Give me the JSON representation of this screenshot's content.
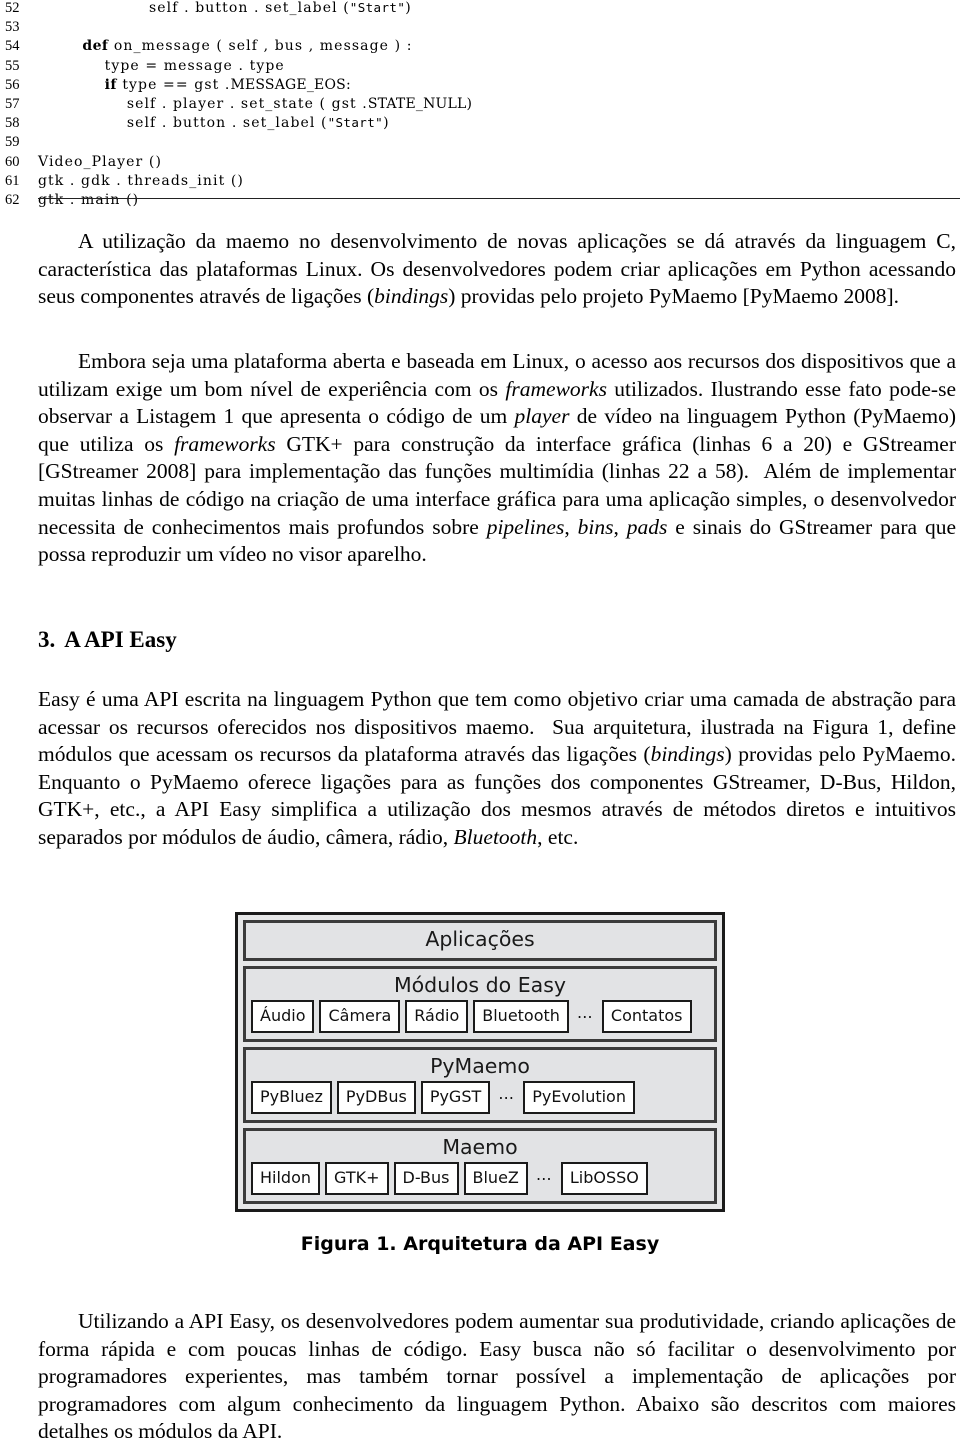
{
  "listing": {
    "lines": [
      {
        "no": "52",
        "indent": 20,
        "segments": [
          {
            "t": "self . button . set_label (",
            "k": "plain"
          },
          {
            "t": "\"Start\"",
            "k": "str"
          },
          {
            "t": ")",
            "k": "plain"
          }
        ]
      },
      {
        "no": "53",
        "indent": 0,
        "segments": []
      },
      {
        "no": "54",
        "indent": 8,
        "segments": [
          {
            "t": "def",
            "k": "kw"
          },
          {
            "t": " on_message ( self , bus , message ) :",
            "k": "plain"
          }
        ]
      },
      {
        "no": "55",
        "indent": 12,
        "segments": [
          {
            "t": "type = message . type",
            "k": "plain"
          }
        ]
      },
      {
        "no": "56",
        "indent": 12,
        "segments": [
          {
            "t": "if",
            "k": "kw"
          },
          {
            "t": " type == gst .",
            "k": "plain"
          },
          {
            "t": "MESSAGE_EOS",
            "k": "sc"
          },
          {
            "t": ":",
            "k": "plain"
          }
        ]
      },
      {
        "no": "57",
        "indent": 16,
        "segments": [
          {
            "t": "self . player . set_state ( gst .",
            "k": "plain"
          },
          {
            "t": "STATE_NULL",
            "k": "sc"
          },
          {
            "t": ")",
            "k": "plain"
          }
        ]
      },
      {
        "no": "58",
        "indent": 16,
        "segments": [
          {
            "t": "self . button . set_label (",
            "k": "plain"
          },
          {
            "t": "\"Start\"",
            "k": "str"
          },
          {
            "t": ")",
            "k": "plain"
          }
        ]
      },
      {
        "no": "59",
        "indent": 0,
        "segments": []
      },
      {
        "no": "60",
        "indent": 0,
        "segments": [
          {
            "t": "Video_Player ()",
            "k": "plain"
          }
        ]
      },
      {
        "no": "61",
        "indent": 0,
        "segments": [
          {
            "t": "gtk . gdk . threads_init ()",
            "k": "plain"
          }
        ]
      },
      {
        "no": "62",
        "indent": 0,
        "segments": [
          {
            "t": "gtk . main ()",
            "k": "plain"
          }
        ]
      }
    ]
  },
  "paragraphs": {
    "p1": "A utilização da maemo no desenvolvimento de novas aplicações se dá através da linguagem C, característica das plataformas Linux. Os desenvolvedores podem criar aplicações em Python acessando seus componentes através de ligações (bindings) providas pelo projeto PyMaemo [PyMaemo 2008].",
    "p2": "Embora seja uma plataforma aberta e baseada em Linux, o acesso aos recursos dos dispositivos que a utilizam exige um bom nível de experiência com os frameworks utilizados. Ilustrando esse fato pode-se observar a Listagem 1 que apresenta o código de um player de vídeo na linguagem Python (PyMaemo) que utiliza os frameworks GTK+ para construção da interface gráfica (linhas 6 a 20) e GStreamer [GStreamer 2008] para implementação das funções multimídia (linhas 22 a 58). Além de implementar muitas linhas de código na criação de uma interface gráfica para uma aplicação simples, o desenvolvedor necessita de conhecimentos mais profundos sobre pipelines, bins, pads e sinais do GStreamer para que possa reproduzir um vídeo no visor aparelho.",
    "p3": "Easy é uma API escrita na linguagem Python que tem como objetivo criar uma camada de abstração para acessar os recursos oferecidos nos dispositivos maemo. Sua arquitetura, ilustrada na Figura 1, define módulos que acessam os recursos da plataforma através das ligações (bindings) providas pelo PyMaemo. Enquanto o PyMaemo oferece ligações para as funções dos componentes GStreamer, D-Bus, Hildon, GTK+, etc., a API Easy simplifica a utilização dos mesmos através de métodos diretos e intuitivos separados por módulos de áudio, câmera, rádio, Bluetooth, etc.",
    "p4": "Utilizando a API Easy, os desenvolvedores podem aumentar sua produtividade, criando aplicações de forma rápida e com poucas linhas de código. Easy busca não só facilitar o desenvolvimento por programadores experientes, mas também tornar possível a implementação de aplicações por programadores com algum conhecimento da linguagem Python. Abaixo são descritos com maiores detalhes os módulos da API."
  },
  "section": {
    "number": "3.",
    "title": "A API Easy"
  },
  "figure": {
    "caption": "Figura 1.  Arquitetura da API Easy",
    "layers": [
      {
        "title": "Aplicações",
        "boxes": []
      },
      {
        "title": "Módulos do Easy",
        "boxes": [
          "Áudio",
          "Câmera",
          "Rádio",
          "Bluetooth",
          "...",
          "Contatos"
        ]
      },
      {
        "title": "PyMaemo",
        "boxes": [
          "PyBluez",
          "PyDBus",
          "PyGST",
          "...",
          "PyEvolution"
        ]
      },
      {
        "title": "Maemo",
        "boxes": [
          "Hildon",
          "GTK+",
          "D-Bus",
          "BlueZ",
          "...",
          "LibOSSO"
        ]
      }
    ]
  },
  "colors": {
    "page_background": "#ffffff",
    "text": "#000000",
    "diagram_fill": "#e6e7e8",
    "diagram_border": "#1a1a1a",
    "module_fill": "#ffffff"
  }
}
